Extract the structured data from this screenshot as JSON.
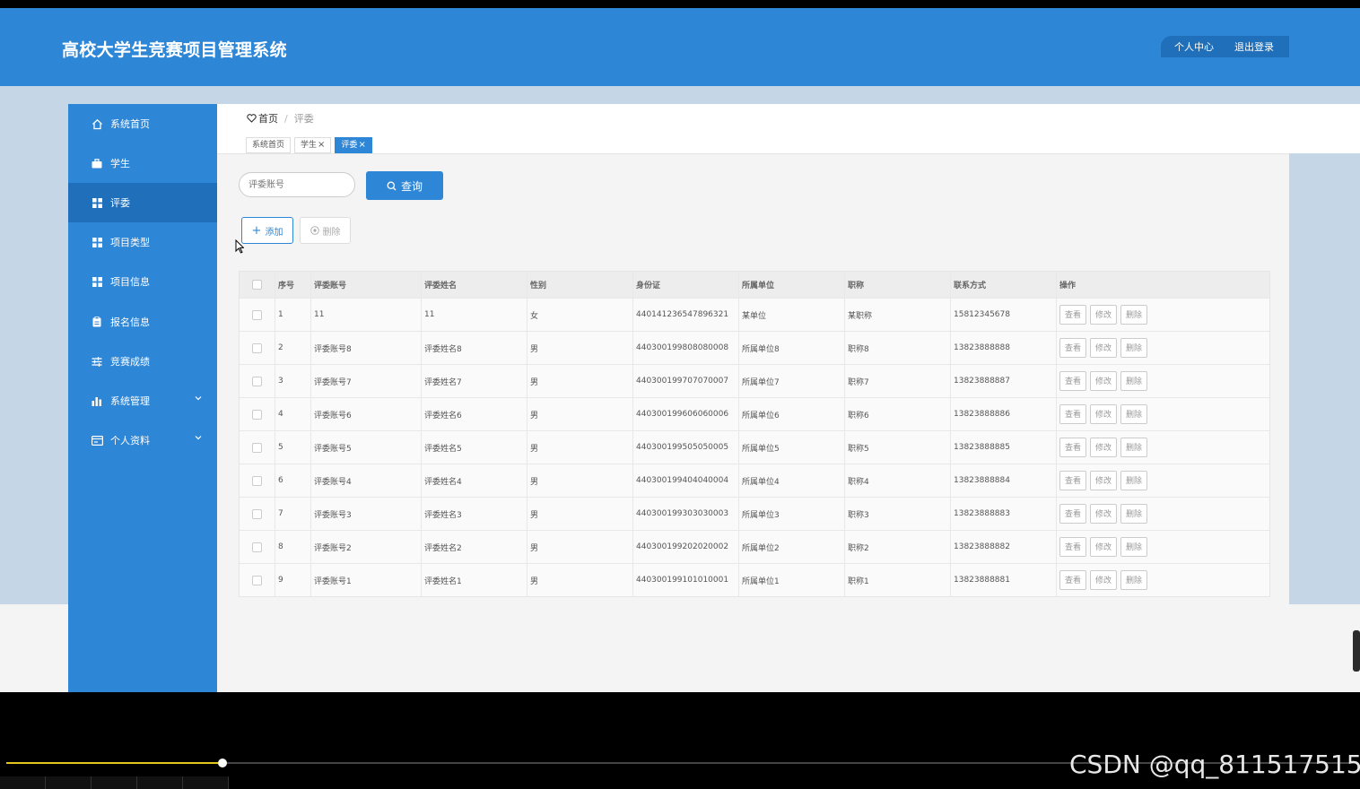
{
  "header": {
    "title": "高校大学生竞赛项目管理系统",
    "user_center": "个人中心",
    "logout": "退出登录"
  },
  "sidebar": {
    "items": [
      {
        "label": "系统首页",
        "icon": "home-icon",
        "active": false,
        "expandable": false
      },
      {
        "label": "学生",
        "icon": "briefcase-icon",
        "active": false,
        "expandable": false
      },
      {
        "label": "评委",
        "icon": "grid-icon",
        "active": true,
        "expandable": false
      },
      {
        "label": "项目类型",
        "icon": "grid-icon",
        "active": false,
        "expandable": false
      },
      {
        "label": "项目信息",
        "icon": "grid-icon",
        "active": false,
        "expandable": false
      },
      {
        "label": "报名信息",
        "icon": "clipboard-icon",
        "active": false,
        "expandable": false
      },
      {
        "label": "竞赛成绩",
        "icon": "sliders-icon",
        "active": false,
        "expandable": false
      },
      {
        "label": "系统管理",
        "icon": "bar-chart-icon",
        "active": false,
        "expandable": true
      },
      {
        "label": "个人资料",
        "icon": "card-icon",
        "active": false,
        "expandable": true
      }
    ]
  },
  "breadcrumb": {
    "home": "首页",
    "separator": "/",
    "current": "评委"
  },
  "tabs": [
    {
      "label": "系统首页",
      "closable": false,
      "active": false
    },
    {
      "label": "学生",
      "closable": true,
      "active": false
    },
    {
      "label": "评委",
      "closable": true,
      "active": true
    }
  ],
  "search": {
    "placeholder": "评委账号",
    "query_label": "查询"
  },
  "toolbar": {
    "add_label": "添加",
    "delete_label": "删除"
  },
  "table": {
    "columns": [
      "序号",
      "评委账号",
      "评委姓名",
      "性别",
      "身份证",
      "所属单位",
      "职称",
      "联系方式",
      "操作"
    ],
    "actions": [
      "查看",
      "修改",
      "删除"
    ],
    "rows": [
      [
        "1",
        "11",
        "11",
        "女",
        "440141236547896321",
        "某单位",
        "某职称",
        "15812345678"
      ],
      [
        "2",
        "评委账号8",
        "评委姓名8",
        "男",
        "440300199808080008",
        "所属单位8",
        "职称8",
        "13823888888"
      ],
      [
        "3",
        "评委账号7",
        "评委姓名7",
        "男",
        "440300199707070007",
        "所属单位7",
        "职称7",
        "13823888887"
      ],
      [
        "4",
        "评委账号6",
        "评委姓名6",
        "男",
        "440300199606060006",
        "所属单位6",
        "职称6",
        "13823888886"
      ],
      [
        "5",
        "评委账号5",
        "评委姓名5",
        "男",
        "440300199505050005",
        "所属单位5",
        "职称5",
        "13823888885"
      ],
      [
        "6",
        "评委账号4",
        "评委姓名4",
        "男",
        "440300199404040004",
        "所属单位4",
        "职称4",
        "13823888884"
      ],
      [
        "7",
        "评委账号3",
        "评委姓名3",
        "男",
        "440300199303030003",
        "所属单位3",
        "职称3",
        "13823888883"
      ],
      [
        "8",
        "评委账号2",
        "评委姓名2",
        "男",
        "440300199202020002",
        "所属单位2",
        "职称2",
        "13823888882"
      ],
      [
        "9",
        "评委账号1",
        "评委姓名1",
        "男",
        "440300199101010001",
        "所属单位1",
        "职称1",
        "13823888881"
      ]
    ]
  },
  "player": {
    "progress": 0.16
  },
  "watermark": "CSDN @qq_811517515",
  "colors": {
    "primary": "#2e86d6",
    "primary_dark": "#1f6fba",
    "band": "#c5d6e6"
  }
}
